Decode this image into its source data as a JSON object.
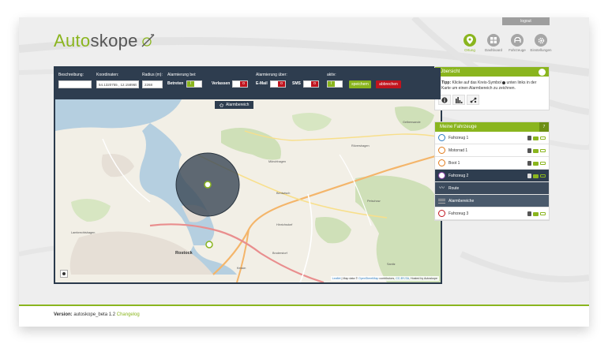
{
  "header": {
    "logout_label": "logout",
    "logo_part1": "Auto",
    "logo_part2": "skope",
    "nav": [
      {
        "label": "Ortung",
        "icon": "location-pin-icon",
        "active": true
      },
      {
        "label": "Dashboard",
        "icon": "dashboard-grid-icon",
        "active": false
      },
      {
        "label": "Fahrzeuge",
        "icon": "vehicle-icon",
        "active": false
      },
      {
        "label": "Einstellungen",
        "icon": "gear-icon",
        "active": false
      }
    ]
  },
  "toolbar": {
    "beschreibung_label": "Beschreibung:",
    "beschreibung_value": "",
    "koordinaten_label": "Koordinaten:",
    "koordinaten_value": "54.1320755 , 12.1589657",
    "radius_label": "Radius (m):",
    "radius_value": "2268",
    "alarm_bei_label": "Alarmierung bei:",
    "betreten_label": "Betreten",
    "verlassen_label": "Verlassen",
    "alarm_ueber_label": "Alarmierung über:",
    "email_label": "E-Mail",
    "sms_label": "SMS",
    "aktiv_label": "aktiv:",
    "save_label": "speichern",
    "cancel_label": "abbrechen"
  },
  "map": {
    "alarm_tab_label": "Alarmbereich",
    "attribution_leaflet": "Leaflet",
    "attribution_mid": " | Map data © ",
    "attribution_osm": "OpenStreetMap",
    "attribution_contrib": " contributors, ",
    "attribution_cc": "CC-BY-SA",
    "attribution_end": ", Hosted by Autoskope",
    "places": {
      "rostock": "Rostock",
      "muenchhagen": "Mönchhagen",
      "bentwisch": "Bentwisch",
      "broderstorf": "Broderstorf",
      "roevershagen": "Rövershagen",
      "gelbensande": "Gelbensande",
      "hinrichsdorf": "Hinrichsdorf",
      "petschow": "Petschow",
      "kessin": "Kessin",
      "hohen_sprenz": "Lambrechtshagen",
      "sanitz": "Sanitz"
    }
  },
  "overview": {
    "title": "Übersicht",
    "tip_bold": "Tipp:",
    "tip_text_1": " Klicke auf das Kreis-Symbol ",
    "tip_text_2": " unten links in der Karte um einen Alarmbereich zu zeichnen."
  },
  "vehicles": {
    "title": "Meine Fahrzeuge",
    "count": "7",
    "items": [
      {
        "name": "Fahrzeug 1",
        "pin_color": "#2a7ac0"
      },
      {
        "name": "Motorrad 1",
        "pin_color": "#e07a1a"
      },
      {
        "name": "Boot 1",
        "pin_color": "#e07a1a"
      },
      {
        "name": "Fahrzeug 2",
        "pin_color": "#8e44ad"
      }
    ],
    "route_label": "Route",
    "alarm_label": "Alarmbereiche",
    "last_item": {
      "name": "Fahrzeug 3",
      "pin_color": "#c0141e"
    }
  },
  "footer": {
    "version_label": "Version:",
    "version_value": " autoskope_beta 1.2 ",
    "changelog_label": "Changelog"
  },
  "colors": {
    "accent": "#8ab51e",
    "toolbar": "#2e3d4f",
    "danger": "#c0141e"
  }
}
